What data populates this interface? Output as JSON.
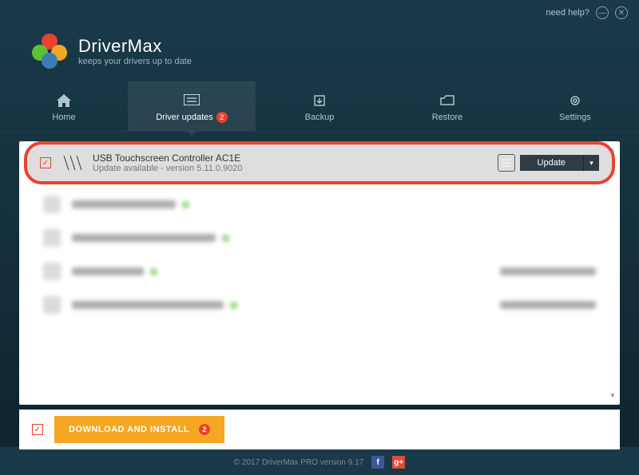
{
  "titlebar": {
    "help": "need help?"
  },
  "brand": {
    "title": "DriverMax",
    "sub": "keeps your drivers up to date"
  },
  "tabs": {
    "home": "Home",
    "updates": "Driver updates",
    "updates_badge": "2",
    "backup": "Backup",
    "restore": "Restore",
    "settings": "Settings"
  },
  "driver": {
    "name": "USB Touchscreen Controller AC1E",
    "status": "Update available - version 5.11.0.9020",
    "button": "Update"
  },
  "download": {
    "label": "DOWNLOAD AND INSTALL",
    "badge": "2"
  },
  "footer": {
    "copyright": "© 2017 DriverMax PRO version 9.17"
  }
}
